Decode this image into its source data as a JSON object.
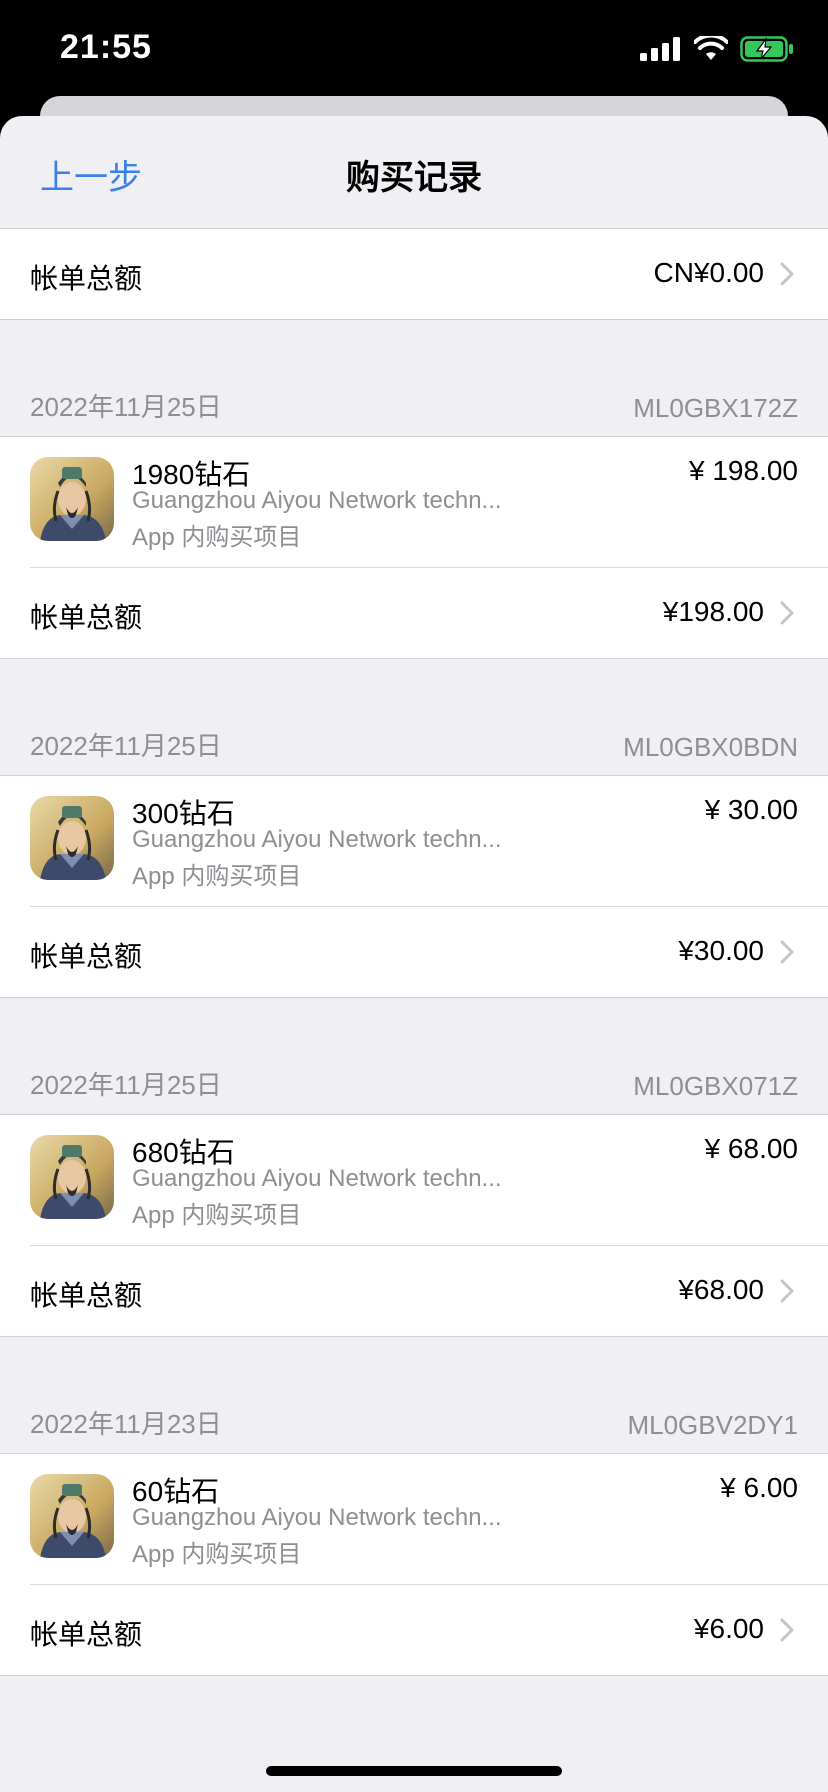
{
  "status": {
    "time": "21:55"
  },
  "nav": {
    "back_label": "上一步",
    "title": "购买记录"
  },
  "top_total": {
    "label": "帐单总额",
    "amount": "CN¥0.00"
  },
  "orders": [
    {
      "date": "2022年11月25日",
      "order_id": "ML0GBX172Z",
      "item": {
        "name": "1980钻石",
        "company": "Guangzhou Aiyou Network techn...",
        "type": "App 内购买项目",
        "price": "¥ 198.00"
      },
      "total_label": "帐单总额",
      "total": "¥198.00"
    },
    {
      "date": "2022年11月25日",
      "order_id": "ML0GBX0BDN",
      "item": {
        "name": "300钻石",
        "company": "Guangzhou Aiyou Network techn...",
        "type": "App 内购买项目",
        "price": "¥ 30.00"
      },
      "total_label": "帐单总额",
      "total": "¥30.00"
    },
    {
      "date": "2022年11月25日",
      "order_id": "ML0GBX071Z",
      "item": {
        "name": "680钻石",
        "company": "Guangzhou Aiyou Network techn...",
        "type": "App 内购买项目",
        "price": "¥ 68.00"
      },
      "total_label": "帐单总额",
      "total": "¥68.00"
    },
    {
      "date": "2022年11月23日",
      "order_id": "ML0GBV2DY1",
      "item": {
        "name": "60钻石",
        "company": "Guangzhou Aiyou Network techn...",
        "type": "App 内购买项目",
        "price": "¥ 6.00"
      },
      "total_label": "帐单总额",
      "total": "¥6.00"
    }
  ],
  "colors": {
    "accent": "#3a80e8",
    "secondary_text": "#8e8e93",
    "battery": "#34c759"
  }
}
